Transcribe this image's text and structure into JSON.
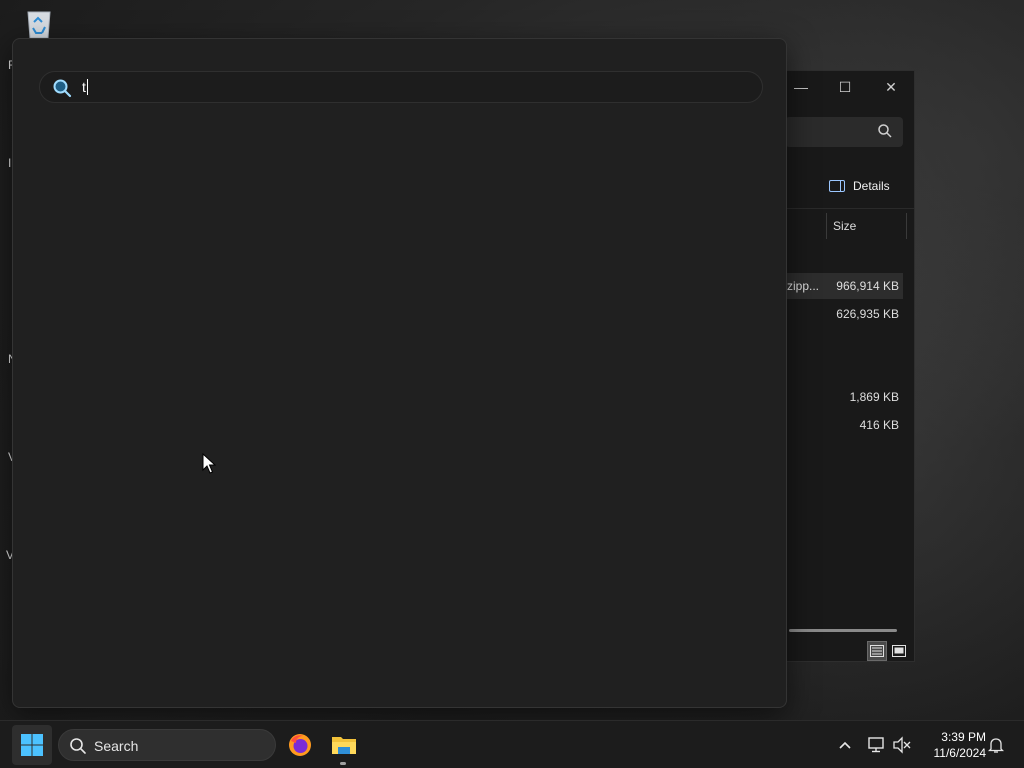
{
  "desktop": {
    "icon_letters": [
      "R",
      "I",
      "N",
      "V",
      "V"
    ]
  },
  "explorer": {
    "minimize_glyph": "—",
    "maximize_glyph": "☐",
    "close_glyph": "✕",
    "details_label": "Details",
    "column_size": "Size",
    "rows": [
      {
        "name": "zipp...",
        "size": "966,914 KB",
        "selected": true
      },
      {
        "name": "",
        "size": "626,935 KB",
        "selected": false
      },
      {
        "name": "",
        "size": "1,869 KB",
        "selected": false
      },
      {
        "name": "",
        "size": "416 KB",
        "selected": false
      }
    ]
  },
  "search_overlay": {
    "query": "t"
  },
  "taskbar": {
    "search_label": "Search",
    "time": "3:39 PM",
    "date": "11/6/2024"
  },
  "colors": {
    "accent": "#4cc2ff",
    "overlay_bg": "#202020",
    "taskbar_bg": "#1c1c1c"
  }
}
